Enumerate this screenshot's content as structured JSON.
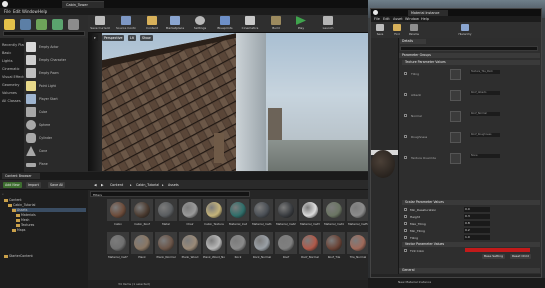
{
  "editor": {
    "tab_title": "Cabin_Tower",
    "menu": [
      "File",
      "Edit",
      "Window",
      "Help"
    ],
    "categories": [
      "Recently Placed",
      "Basic",
      "Lights",
      "Cinematic",
      "Visual Effects",
      "Geometry",
      "Volumes",
      "All Classes"
    ],
    "place_items": [
      "Empty Actor",
      "Empty Character",
      "Empty Pawn",
      "Point Light",
      "Player Start",
      "Cube",
      "Sphere",
      "Cylinder",
      "Cone",
      "Plane"
    ],
    "toolbar": [
      "Save Current",
      "Source Control",
      "Content",
      "Marketplace",
      "Settings",
      "Blueprints",
      "Cinematics",
      "Build",
      "Play",
      "Launch"
    ],
    "viewport_chips": [
      "Perspective",
      "Lit",
      "Show"
    ]
  },
  "content_browser": {
    "tab": "Content Browser",
    "buttons": [
      "Add New",
      "Import",
      "Save All"
    ],
    "path": [
      "Content",
      "Cabin_Tutorial",
      "Assets"
    ],
    "filters_label": "Filters",
    "tree": [
      {
        "label": "Content",
        "depth": 0
      },
      {
        "label": "Cabin_Tutorial",
        "depth": 1
      },
      {
        "label": "Assets",
        "depth": 2
      },
      {
        "label": "Materials",
        "depth": 3
      },
      {
        "label": "Mesh",
        "depth": 3
      },
      {
        "label": "Textures",
        "depth": 3
      },
      {
        "label": "Maps",
        "depth": 2
      },
      {
        "label": "StarterContent",
        "depth": 0
      }
    ],
    "assets_row1": [
      {
        "label": "Cabin",
        "color": "#6d4c3a"
      },
      {
        "label": "Cabin_Roof",
        "color": "#4b3b30"
      },
      {
        "label": "Metal",
        "color": "#5a5d60"
      },
      {
        "label": "Chair",
        "color": "#9a9a9a"
      },
      {
        "label": "Cabin_Texture",
        "color": "#c5b47a"
      },
      {
        "label": "Material_Inst",
        "color": "#2f6e6a"
      },
      {
        "label": "Material_Inst1",
        "color": "#4a4f55"
      },
      {
        "label": "Material_Inst2",
        "color": "#3a3d41"
      },
      {
        "label": "Material_Inst3",
        "color": "#dcdcdc"
      },
      {
        "label": "Material_Inst4",
        "color": "#6b7563"
      },
      {
        "label": "Material_Inst5",
        "color": "#8c8c8c"
      },
      {
        "label": "Material_Inst6",
        "color": "#5d5f62"
      }
    ],
    "assets_row2": [
      {
        "label": "Material_Inst7",
        "color": "#707070"
      },
      {
        "label": "Plank",
        "color": "#8a7764"
      },
      {
        "label": "Plank_Normal",
        "color": "#6b5548"
      },
      {
        "label": "Plank_Wood",
        "color": "#9a8a78"
      },
      {
        "label": "Plank_Wood_Normal",
        "color": "#b8b8b8"
      },
      {
        "label": "Rock",
        "color": "#8a8a8a"
      },
      {
        "label": "Rock_Normal",
        "color": "#9aa0a6"
      },
      {
        "label": "Roof",
        "color": "#7f7f7f"
      },
      {
        "label": "Roof_Normal",
        "color": "#b05a4a"
      },
      {
        "label": "Roof_Tile",
        "color": "#6a4336"
      },
      {
        "label": "Tile_Normal",
        "color": "#a06a5a"
      },
      {
        "label": "Wall",
        "color": "#8b6a54"
      }
    ],
    "status": "34 items (1 selected)"
  },
  "material_editor": {
    "tab_title": "Material Instance",
    "menu": [
      "File",
      "Edit",
      "Asset",
      "Window",
      "Help"
    ],
    "toolbar": [
      "Save",
      "Find",
      "Params",
      "Hierarchy"
    ],
    "details_tab": "Details",
    "sections": [
      "Parameter Groups",
      "Texture Parameter Values",
      "Scalar Parameter Values",
      "Vector Parameter Values",
      "General"
    ],
    "texture_params": [
      {
        "label": "Tiling",
        "value": "Texture_Tile_Pack"
      },
      {
        "label": "Albedo",
        "value": "Roof_Albedo"
      },
      {
        "label": "Normal",
        "value": "Roof_Normal"
      },
      {
        "label": "Roughness",
        "value": "Roof_Roughness"
      },
      {
        "label": "Texture Override",
        "value": "None"
      }
    ],
    "scalar_params": [
      {
        "label": "Min_Desaturation",
        "value": "0.0"
      },
      {
        "label": "Height",
        "value": "0.3"
      },
      {
        "label": "Max_Tiling",
        "value": "0.8"
      },
      {
        "label": "Min_Tiling",
        "value": "0.2"
      },
      {
        "label": "Tiling",
        "value": "1.0"
      }
    ],
    "vector_param": {
      "label": "Tint Color",
      "color": "#c21a1a"
    },
    "vector_buttons": [
      "Base Setting",
      "Reset Child"
    ],
    "taskbar_info": "New Material Instance"
  }
}
